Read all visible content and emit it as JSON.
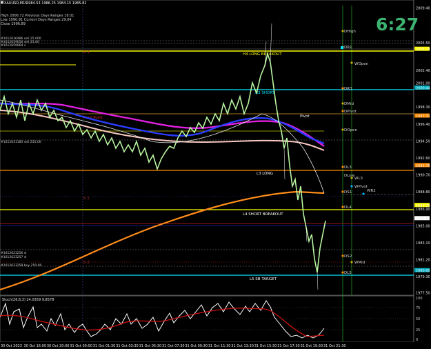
{
  "title": "XAUUSD,M15",
  "ohlc": "1984.53 1986.25 1984.15 1985.82",
  "stats": [
    "High 2006.72   Previous Days Ranges 18.01",
    "Low  1990.91   Current Days Ranges 29.04",
    "Close 1996.89"
  ],
  "orders": [
    "#1012636486 sell 25.000",
    "#1012659056 sell 25.00",
    "#1012659064 s"
  ],
  "order_left_1": "#1012631185 sell 250.00",
  "order_left_2": [
    "#1012623256 sl",
    "#1012623257 sl",
    "#1012623258 buy 250.00"
  ],
  "timer": "6:27",
  "levels": {
    "h4": "H4 LONG BREAKOUT",
    "h3": "H3 SHORT",
    "pivot_point": "Pivot Point",
    "l3": "L3 LONG",
    "l4": "L4 SHORT BREAKOUT",
    "l5": "L5 SB TARGET",
    "pivot": "Pivot",
    "s1": "S 1",
    "s2": "S 2",
    "r1": "R 1"
  },
  "markers": [
    "DHigh",
    "DR1",
    "WOpen",
    "DR3",
    "DMid",
    "DPivot",
    "DOpen",
    "DL3",
    "DLow",
    "WL3",
    "WPivot",
    "DS1",
    "WR2",
    "DL4",
    "DS2",
    "WMid",
    "DL5"
  ],
  "price_labels": [
    "2009.40",
    "2005.50",
    "2004.79",
    "2002.40",
    "2001.00",
    "2000.44",
    "1998.30",
    "1997.31",
    "1996.40",
    "1994.50",
    "1992.60",
    "1991.76",
    "1990.70",
    "1988.80",
    "1987.29",
    "1986.90",
    "1985.82",
    "1985.00",
    "1983.10",
    "1981.20",
    "1980.00",
    "1979.30",
    "1977.50"
  ],
  "price_highlights": [
    "2004.79",
    "2000.44",
    "1997.31",
    "1991.76",
    "1987.29",
    "1985.82",
    "1980.00"
  ],
  "indicator_label": "Stoch(26,6,3) 24.0359 9.8578",
  "stoch_levels": [
    "100",
    "75",
    "50",
    "25",
    "0"
  ],
  "time_labels": [
    "30 Oct 2023",
    "30 Oct 16:00",
    "30 Oct 20:00",
    "31 Oct 00:00",
    "31 Oct 01:30",
    "31 Oct 03:30",
    "31 Oct 05:30",
    "31 Oct 07:30",
    "31 Oct 09:30",
    "31 Oct 11:30",
    "31 Oct 13:30",
    "31 Oct 15:30",
    "31 Oct 17:30",
    "31 Oct 19:30",
    "31 Oct 21:30"
  ],
  "colors": {
    "background": "#000000",
    "bull_candle": "#b8f5a0",
    "bear_candle": "#ffffff",
    "timer": "#3cb371",
    "h_level": "#ffff00",
    "l_level": "#ff8c00",
    "cyan_level": "#00ffff",
    "ma_blue": "#2a3cff",
    "ma_magenta": "#e020e0",
    "ma_pink": "#f7c8c0",
    "ma_orange": "#ff8c1a",
    "stoch_main": "#ffffff",
    "stoch_signal": "#d01010"
  }
}
